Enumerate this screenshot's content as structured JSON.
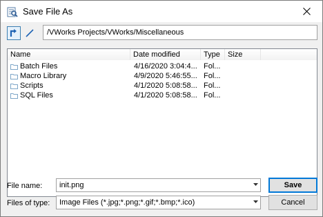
{
  "window": {
    "title": "Save File As",
    "app_icon": "search-spreadsheet-icon",
    "close_icon": "close-icon"
  },
  "toolbar": {
    "up_icon": "up-folder-icon",
    "new_folder_icon": "new-folder-icon",
    "path": "/VWorks Projects/VWorks/Miscellaneous"
  },
  "file_list": {
    "columns": [
      "Name",
      "Date modified",
      "Type",
      "Size"
    ],
    "rows": [
      {
        "name": "Batch Files",
        "date": "4/16/2020 3:04:4...",
        "type": "Fol...",
        "size": ""
      },
      {
        "name": "Macro Library",
        "date": "4/9/2020 5:46:55...",
        "type": "Fol...",
        "size": ""
      },
      {
        "name": "Scripts",
        "date": "4/1/2020 5:08:58...",
        "type": "Fol...",
        "size": ""
      },
      {
        "name": "SQL Files",
        "date": "4/1/2020 5:08:58...",
        "type": "Fol...",
        "size": ""
      }
    ]
  },
  "form": {
    "file_name_label": "File name:",
    "file_name_value": "init.png",
    "file_type_label": "Files of type:",
    "file_type_value": "Image Files (*.jpg;*.png;*.gif;*.bmp;*.ico)"
  },
  "buttons": {
    "save": "Save",
    "cancel": "Cancel"
  },
  "colors": {
    "accent": "#0078d7",
    "folder": "#dcb35c"
  }
}
